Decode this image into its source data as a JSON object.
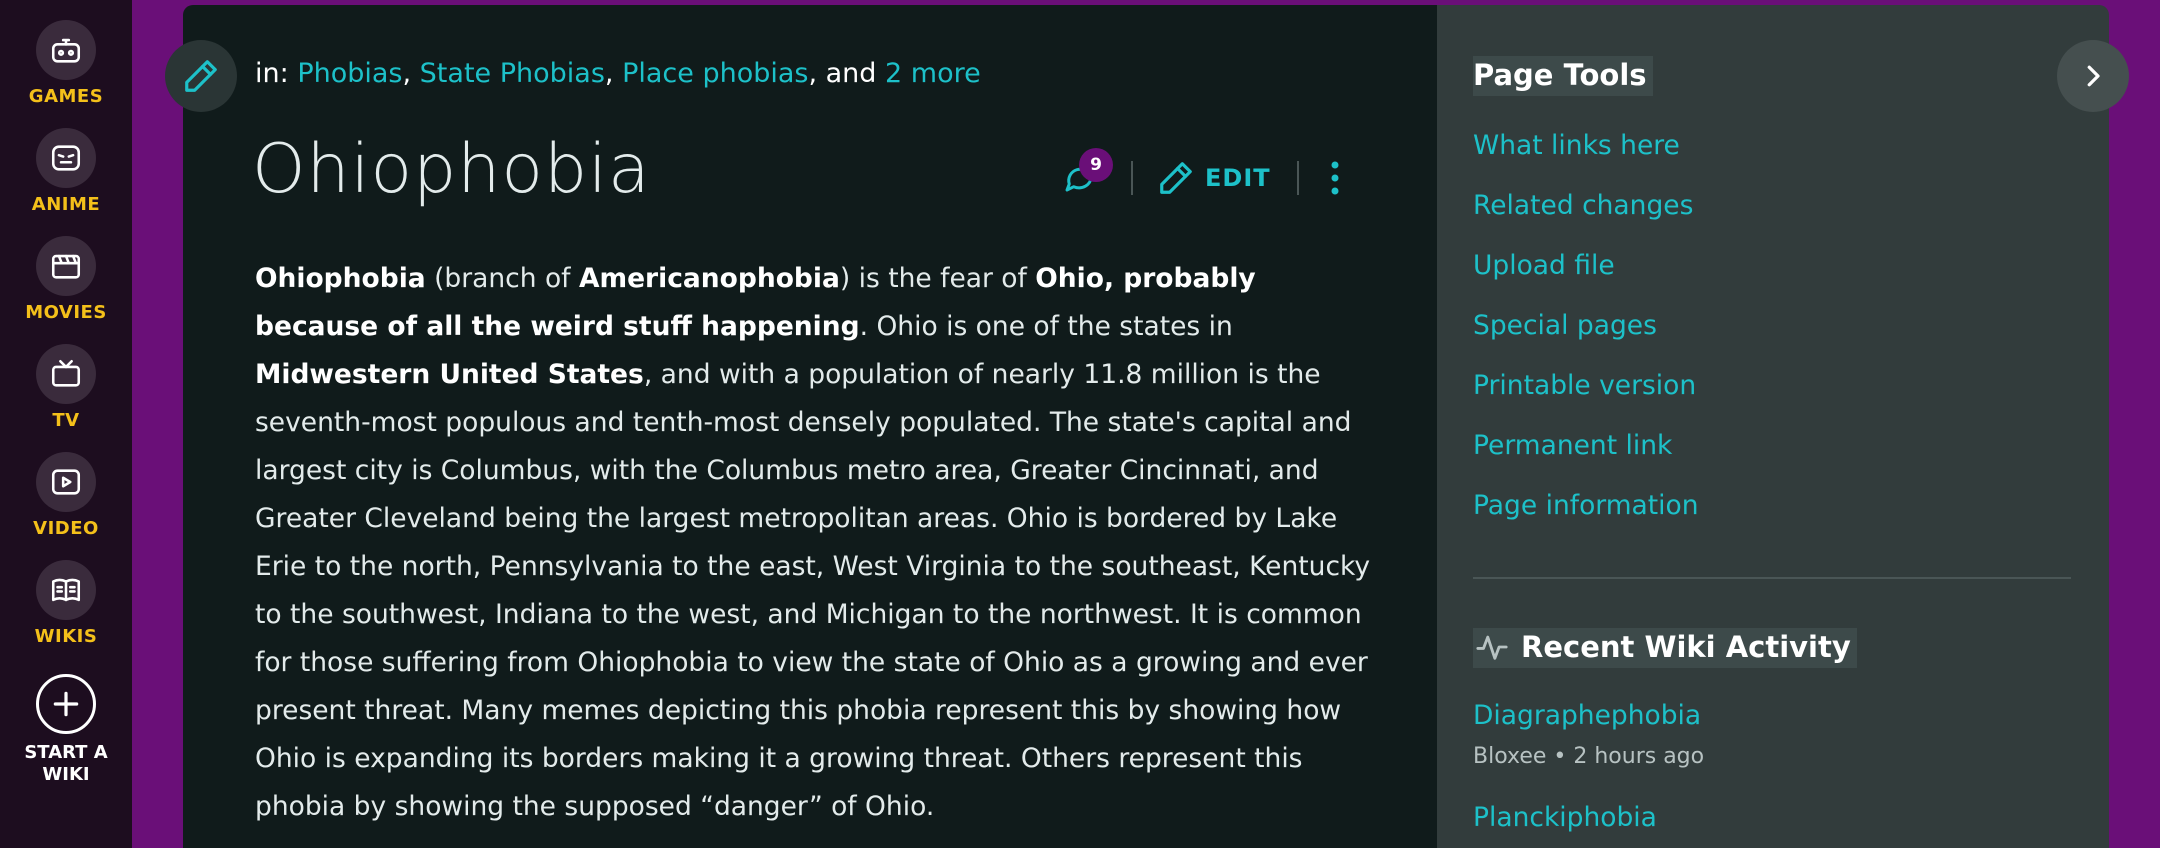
{
  "global_nav": {
    "items": [
      {
        "label": "GAMES",
        "icon": "controller-icon"
      },
      {
        "label": "ANIME",
        "icon": "anime-face-icon"
      },
      {
        "label": "MOVIES",
        "icon": "clapperboard-icon"
      },
      {
        "label": "TV",
        "icon": "tv-icon"
      },
      {
        "label": "VIDEO",
        "icon": "play-icon"
      },
      {
        "label": "WIKIS",
        "icon": "book-icon"
      }
    ],
    "start_wiki_line1": "START A",
    "start_wiki_line2": "WIKI"
  },
  "article": {
    "categories": {
      "prefix": "in:",
      "links": [
        "Phobias",
        "State Phobias",
        "Place phobias"
      ],
      "joiner": ", and",
      "more": "2 more"
    },
    "title": "Ohiophobia",
    "comments_count": "9",
    "edit_label": "EDIT",
    "body": {
      "s1": "Ohiophobia",
      "s2": " (branch of ",
      "s3": "Americanophobia",
      "s4": ") is the fear of ",
      "s5": "Ohio, probably because of all the weird stuff happening",
      "s6": ". Ohio is one of the states in ",
      "s7": "Midwestern United States",
      "s8": ", and with a population of nearly 11.8 million is the seventh-most populous and tenth-most densely populated. The state's capital and largest city is Columbus, with the Columbus metro area, Greater Cincinnati, and Greater Cleveland being the largest metropolitan areas. Ohio is bordered by Lake Erie to the north, Pennsylvania to the east, West Virginia to the southeast, Kentucky to the southwest, Indiana to the west, and Michigan to the northwest. It is common for those suffering from Ohiophobia to view the state of Ohio as a growing and ever present threat. Many memes depicting this phobia represent this by showing how Ohio is expanding its borders making it a growing threat. Others represent this phobia by showing the supposed “danger” of Ohio."
    }
  },
  "rail": {
    "page_tools_title": "Page Tools",
    "tools": [
      "What links here",
      "Related changes",
      "Upload file",
      "Special pages",
      "Printable version",
      "Permanent link",
      "Page information"
    ],
    "activity_title": "Recent Wiki Activity",
    "activity": [
      {
        "title": "Diagraphephobia",
        "meta": "Bloxee • 2 hours ago"
      },
      {
        "title": "Planckiphobia",
        "meta": ""
      }
    ]
  },
  "colors": {
    "accent": "#1dc1c9",
    "nav_label": "#f4c01a",
    "background": "#6a0f78",
    "article_bg": "#101b1b",
    "rail_bg": "#323c3c"
  }
}
